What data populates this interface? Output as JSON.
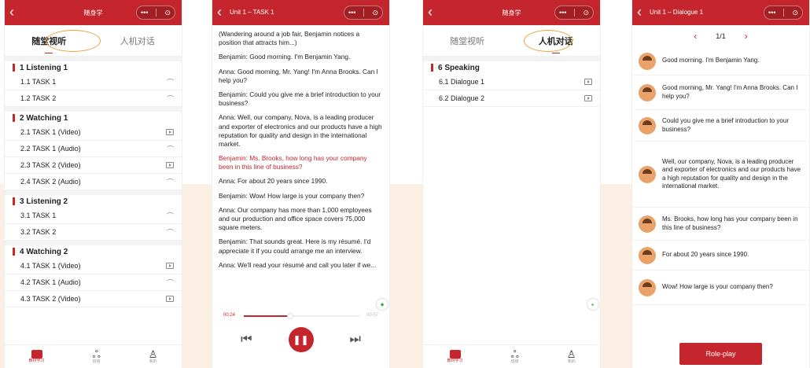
{
  "phone1": {
    "title": "随身学",
    "capsule": {
      "dots": "•••",
      "close": "⊙"
    },
    "tabs": [
      "随堂视听",
      "人机对话"
    ],
    "sections": [
      {
        "name": "1 Listening 1",
        "items": [
          {
            "label": "1.1 TASK 1",
            "icon": "headphones-icon"
          },
          {
            "label": "1.2 TASK 2",
            "icon": "headphones-icon"
          }
        ]
      },
      {
        "name": "2 Watching 1",
        "items": [
          {
            "label": "2.1 TASK 1 (Video)",
            "icon": "video-icon"
          },
          {
            "label": "2.2 TASK 1 (Audio)",
            "icon": "headphones-icon"
          },
          {
            "label": "2.3 TASK 2 (Video)",
            "icon": "video-icon"
          },
          {
            "label": "2.4 TASK 2 (Audio)",
            "icon": "headphones-icon"
          }
        ]
      },
      {
        "name": "3 Listening 2",
        "items": [
          {
            "label": "3.1 TASK 1",
            "icon": "headphones-icon"
          },
          {
            "label": "3.2 TASK 2",
            "icon": "headphones-icon"
          }
        ]
      },
      {
        "name": "4 Watching 2",
        "items": [
          {
            "label": "4.1 TASK 1 (Video)",
            "icon": "video-icon"
          },
          {
            "label": "4.2 TASK 1 (Audio)",
            "icon": "headphones-icon"
          },
          {
            "label": "4.3 TASK 2 (Video)",
            "icon": "video-icon"
          }
        ]
      }
    ],
    "nav": [
      {
        "label": "教材学习",
        "icon": "book-icon"
      },
      {
        "label": "班级",
        "icon": "group-icon"
      },
      {
        "label": "我的",
        "icon": "profile-icon"
      }
    ]
  },
  "phone2": {
    "title": "Unit 1 – TASK 1",
    "capsule": {
      "dots": "•••",
      "close": "⊙"
    },
    "paragraphs": [
      {
        "text": "(Wandering around a job fair, Benjamin notices a position that attracts him...)",
        "highlight": false
      },
      {
        "text": "Benjamin: Good morning. I'm Benjamin Yang.",
        "highlight": false
      },
      {
        "text": "Anna: Good morning, Mr. Yang! I'm Anna Brooks. Can I help you?",
        "highlight": false
      },
      {
        "text": "Benjamin: Could you give me a brief introduction to your business?",
        "highlight": false
      },
      {
        "text": "Anna: Well, our company, Nova, is a leading producer and exporter of electronics and our products have a high reputation for quality and design in the international market.",
        "highlight": false
      },
      {
        "text": "Benjamin: Ms. Brooks, how long has your company been in this line of business?",
        "highlight": true
      },
      {
        "text": "Anna: For about 20 years since 1990.",
        "highlight": false
      },
      {
        "text": "Benjamin: Wow! How large is your company then?",
        "highlight": false
      },
      {
        "text": "Anna: Our company has more than 1,000 employees and our production and office space covers 75,000 square meters.",
        "highlight": false
      },
      {
        "text": "Benjamin: That sounds great. Here is my résumé. I'd appreciate it if you could arrange me an interview.",
        "highlight": false
      },
      {
        "text": "Anna: We'll read your résumé and call you later if we...",
        "highlight": false
      }
    ],
    "player": {
      "current": "00:24",
      "total": "00:57",
      "progress": 0.4
    }
  },
  "phone3": {
    "title": "随身学",
    "capsule": {
      "dots": "•••",
      "close": "⊙"
    },
    "tabs": [
      "随堂视听",
      "人机对话"
    ],
    "section": "6 Speaking",
    "items": [
      {
        "label": "6.1 Dialogue 1",
        "icon": "video-icon"
      },
      {
        "label": "6.2 Dialogue 2",
        "icon": "video-icon"
      }
    ],
    "nav": [
      {
        "label": "教材学习",
        "icon": "book-icon"
      },
      {
        "label": "班级",
        "icon": "group-icon"
      },
      {
        "label": "我的",
        "icon": "profile-icon"
      }
    ]
  },
  "phone4": {
    "title": "Unit 1 – Dialogue 1",
    "capsule": {
      "dots": "•••",
      "close": "⊙"
    },
    "pager": {
      "prev": "‹",
      "text": "1/1",
      "next": "›"
    },
    "messages": [
      "Good morning. I'm Benjamin Yang.",
      "Good morning, Mr. Yang! I'm Anna Brooks. Can I help you?",
      "Could you give me a brief introduction to your business?",
      "Well, our company, Nova, is a leading producer and exporter of electronics and our products have a high reputation for quality and design in the international market.",
      "Ms. Brooks, how long has your company been in this line of business?",
      "For about 20 years since 1990.",
      "Wow! How large is your company then?"
    ],
    "roleplay": "Role-play"
  }
}
